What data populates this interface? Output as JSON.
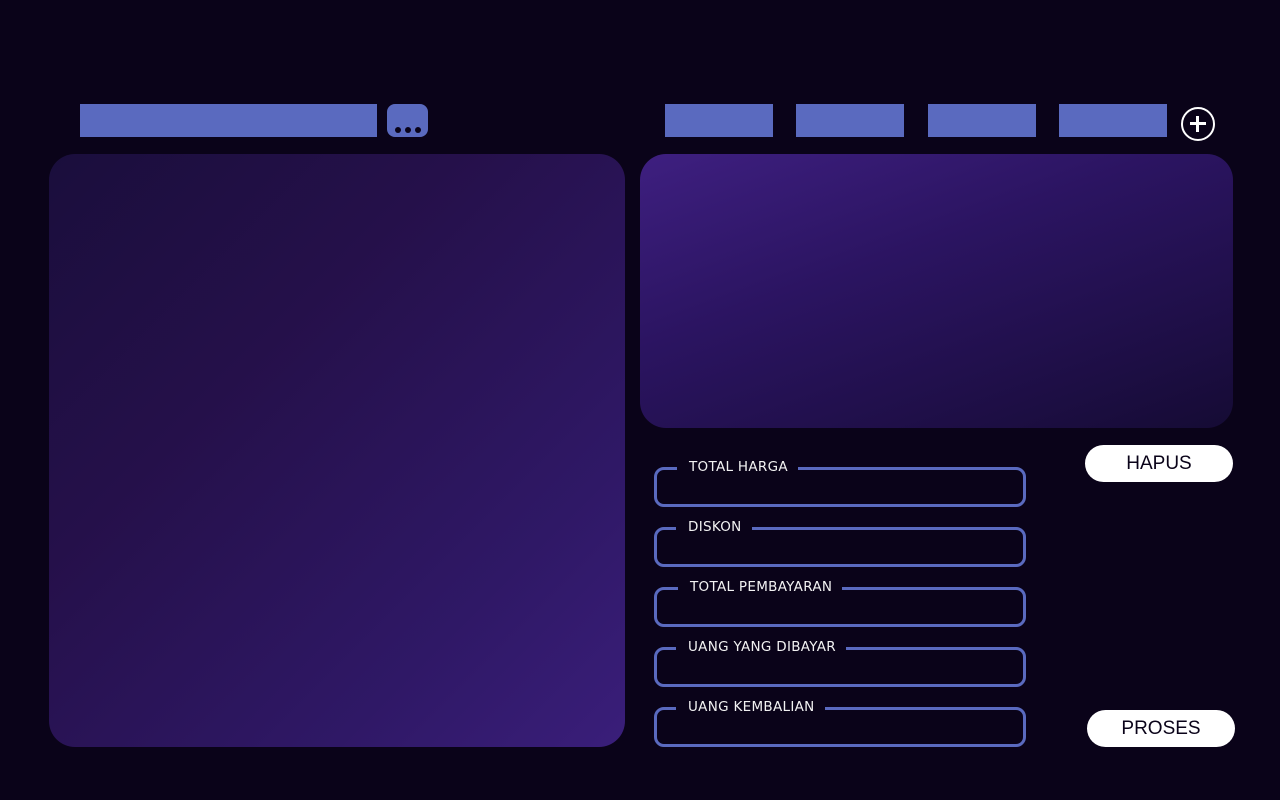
{
  "colors": {
    "background": "#0a0319",
    "accent": "#5a6abf",
    "panel_primary": "#2f1866",
    "button_background": "#ffffff",
    "label_text": "#f2f2f2"
  },
  "icons": {
    "menu": "more-dots-icon",
    "add": "plus-circle-icon"
  },
  "payment": {
    "fields": [
      {
        "label": "TOTAL HARGA"
      },
      {
        "label": "DISKON"
      },
      {
        "label": "TOTAL PEMBAYARAN"
      },
      {
        "label": "UANG YANG DIBAYAR"
      },
      {
        "label": "UANG KEMBALIAN"
      }
    ]
  },
  "actions": {
    "clear_label": "HAPUS",
    "process_label": "PROSES"
  }
}
